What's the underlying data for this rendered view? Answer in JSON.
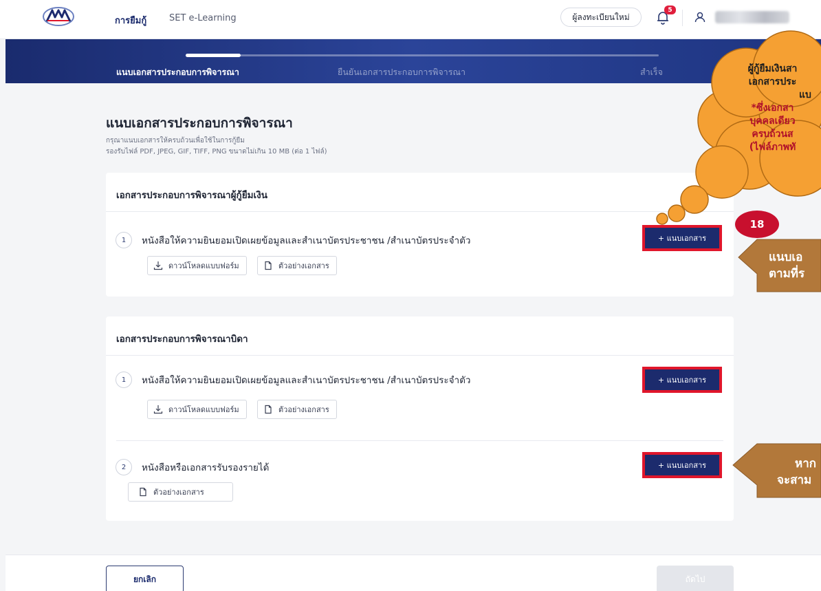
{
  "topnav": {
    "links": [
      {
        "label": "การยืมกู้"
      },
      {
        "label": "SET e-Learning"
      }
    ],
    "register_label": "ผู้ลงทะเบียนใหม่",
    "notification_count": "5"
  },
  "stepper": {
    "steps": [
      {
        "label": "แนบเอกสารประกอบการพิจารณา"
      },
      {
        "label": "ยืนยันเอกสารประกอบการพิจารณา"
      },
      {
        "label": "สำเร็จ"
      }
    ],
    "current_step": 1
  },
  "page": {
    "title": "แนบเอกสารประกอบการพิจารณา",
    "subtitle_1": "กรุณาแนบเอกสารให้ครบถ้วนเพื่อใช้ในการกู้ยืม",
    "subtitle_2": "รองรับไฟล์ PDF, JPEG, GIF, TIFF, PNG ขนาดไม่เกิน 10 MB (ต่อ 1 ไฟล์)"
  },
  "sections": [
    {
      "title": "เอกสารประกอบการพิจารณาผู้กู้ยืมเงิน",
      "documents": [
        {
          "number": "1",
          "title": "หนังสือให้ความยินยอมเปิดเผยข้อมูลและสำเนาบัตรประชาชน /สำเนาบัตรประจำตัว",
          "download_label": "ดาวน์โหลดแบบฟอร์ม",
          "sample_label": "ตัวอย่างเอกสาร",
          "attach_label": "+ แนบเอกสาร"
        }
      ]
    },
    {
      "title": "เอกสารประกอบการพิจารณาบิดา",
      "documents": [
        {
          "number": "1",
          "title": "หนังสือให้ความยินยอมเปิดเผยข้อมูลและสำเนาบัตรประชาชน /สำเนาบัตรประจำตัว",
          "download_label": "ดาวน์โหลดแบบฟอร์ม",
          "sample_label": "ตัวอย่างเอกสาร",
          "attach_label": "+ แนบเอกสาร"
        },
        {
          "number": "2",
          "title": "หนังสือหรือเอกสารรับรองรายได้",
          "sample_label": "ตัวอย่างเอกสาร",
          "attach_label": "+ แนบเอกสาร"
        }
      ]
    }
  ],
  "footer": {
    "cancel_label": "ยกเลิก",
    "next_label": "ถัดไป"
  },
  "annotation": {
    "cloud_lines": [
      "ผู้กู้ยืมเงินสา",
      "เอกสารประ",
      "แบ",
      "*ซึ่งเอกสา",
      "บุคคลเดียว",
      "ครบถ้วนส",
      "(ไฟล์ภาพทั"
    ],
    "step_number": "18",
    "callout_1_lines": [
      "แนบเอ",
      "ตามที่ร"
    ],
    "callout_2_lines": [
      "หาก",
      "จะสาม"
    ]
  },
  "colors": {
    "brand_navy": "#1c2b6d",
    "highlight_red": "#e0162b",
    "annotation_orange": "#f5a033",
    "callout_brown": "#b2783a"
  }
}
